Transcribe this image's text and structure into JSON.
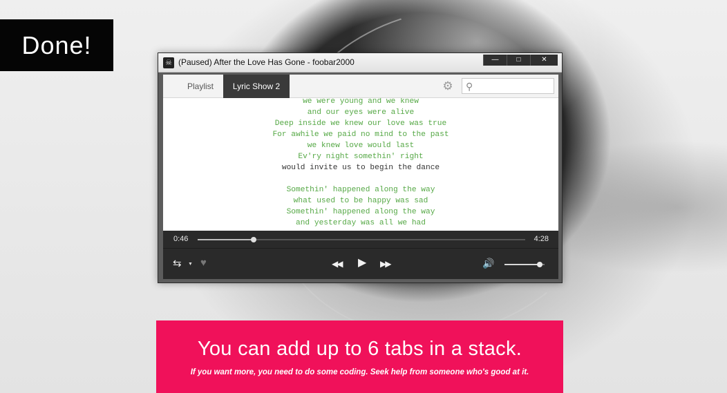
{
  "overlay": {
    "done_label": "Done!"
  },
  "window": {
    "title": "(Paused) After the Love Has Gone - foobar2000",
    "app_icon": "skull-icon",
    "controls": {
      "minimize": "—",
      "maximize": "□",
      "close": "✕"
    }
  },
  "tabs": [
    {
      "label": "Playlist",
      "active": false
    },
    {
      "label": "Lyric Show 2",
      "active": true
    }
  ],
  "toolbar": {
    "settings_icon": "gear-icon",
    "search_icon": "search-icon",
    "search_value": ""
  },
  "lyrics": {
    "lines": [
      "we were young and we knew",
      "and our eyes were alive",
      "Deep inside we knew our love was true",
      "For awhile we paid no mind to the past",
      "we knew love would last",
      "Ev'ry night somethin' right",
      "would invite us to begin the dance",
      "",
      "Somethin' happened along the way",
      "what used to be happy was sad",
      "Somethin' happened along the way",
      "and yesterday was all we had"
    ],
    "current_line_index": 6,
    "colors": {
      "past": "#55a845",
      "current": "#333333"
    }
  },
  "playback": {
    "elapsed": "0:46",
    "total": "4:28",
    "progress": 0.17,
    "state": "paused",
    "volume": 0.88
  },
  "player_icons": {
    "repeat": "repeat-icon",
    "favorite": "heart-icon",
    "previous": "previous-icon",
    "play": "play-icon",
    "next": "next-icon",
    "volume": "speaker-icon"
  },
  "banner": {
    "title": "You can add up to 6 tabs in a stack.",
    "subtitle": "If you want more, you need to do some coding. Seek help from someone who's good at it.",
    "color": "#f0115a"
  }
}
